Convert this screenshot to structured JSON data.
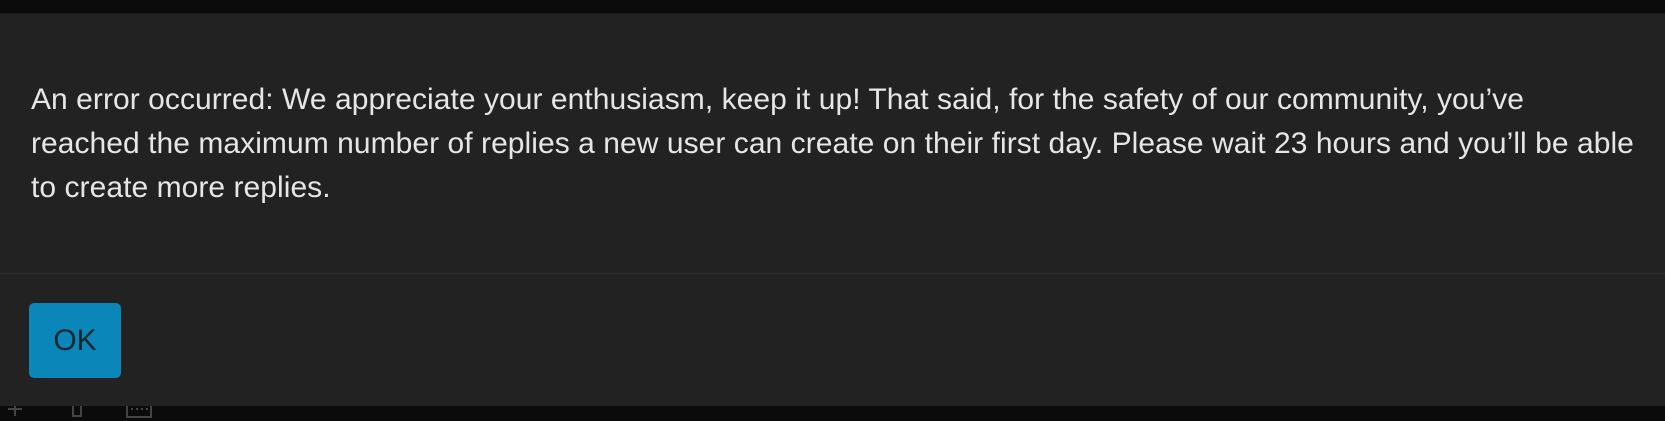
{
  "dialog": {
    "message": "An error occurred: We appreciate your enthusiasm, keep it up! That said, for the safety of our community, you’ve reached the maximum number of replies a new user can create on their first day. Please wait 23 hours and you’ll be able to create more replies.",
    "ok_label": "OK"
  },
  "colors": {
    "dialog_background": "#222222",
    "backdrop": "#0b0b0b",
    "accent_button": "#0a86b8",
    "text": "#e6e6e6"
  },
  "icons": {
    "backdrop_left": "plus-icon",
    "backdrop_middle": "bracket-icon",
    "backdrop_right": "keyboard-icon"
  }
}
